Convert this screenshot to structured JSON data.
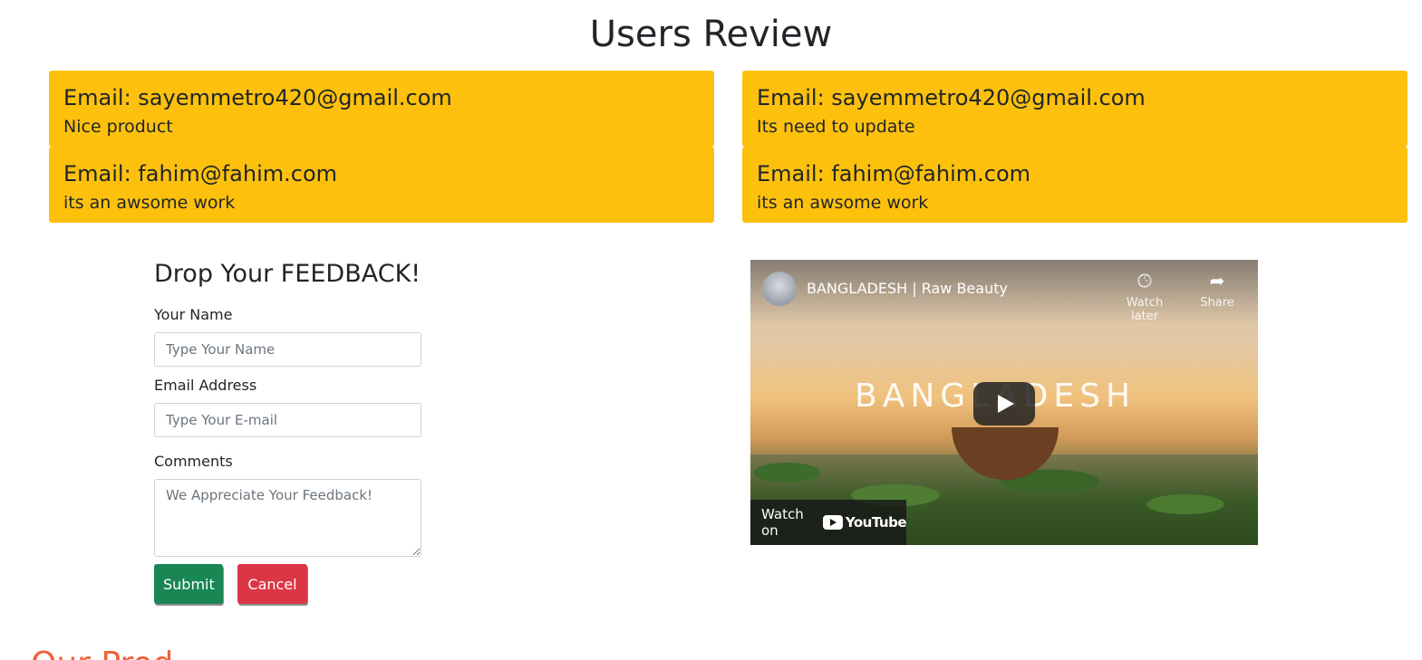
{
  "header": {
    "title": "Users Review"
  },
  "reviews": [
    {
      "email_label": "Email: sayemmetro420@gmail.com",
      "comment": "Nice product"
    },
    {
      "email_label": "Email: sayemmetro420@gmail.com",
      "comment": "Its need to update"
    },
    {
      "email_label": "Email: fahim@fahim.com",
      "comment": "its an awsome work"
    },
    {
      "email_label": "Email: fahim@fahim.com",
      "comment": "its an awsome work"
    }
  ],
  "feedback": {
    "title": "Drop Your FEEDBACK!",
    "name_label": "Your Name",
    "name_placeholder": "Type Your Name",
    "email_label": "Email Address",
    "email_placeholder": "Type Your E-mail",
    "comments_label": "Comments",
    "comments_placeholder": "We Appreciate Your Feedback!",
    "submit_label": "Submit",
    "cancel_label": "Cancel"
  },
  "video": {
    "title": "BANGLADESH | Raw Beauty",
    "brand_text": "BANGLADESH",
    "watch_later_label": "Watch later",
    "share_label": "Share",
    "watch_on_label": "Watch on",
    "youtube_label": "YouTube"
  },
  "footer": {
    "cut_heading": "Our Prod"
  },
  "colors": {
    "review_card": "#fdc10d",
    "submit": "#198754",
    "cancel": "#dc3545",
    "accent_heading": "#f0613a"
  }
}
